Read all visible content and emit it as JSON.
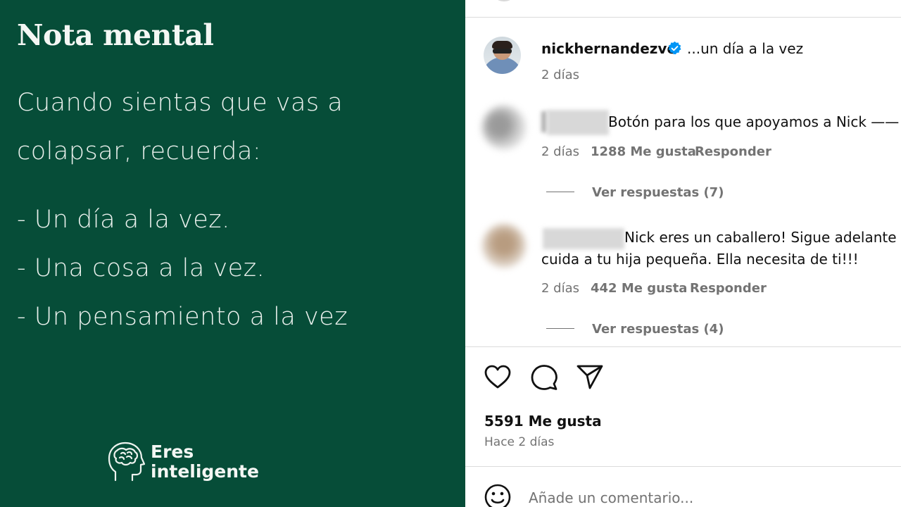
{
  "post_image": {
    "title": "Nota mental",
    "body_lines": [
      "Cuando sientas que vas a",
      "colapsar, recuerda:"
    ],
    "list_items": [
      "- Un día a la vez.",
      "- Una cosa a la vez.",
      "- Un pensamiento a la vez"
    ],
    "brand": {
      "line1": "Eres",
      "line2": "inteligente",
      "icon": "brain-head-icon"
    }
  },
  "caption": {
    "username": "nickhernandezve",
    "text": "...un día a la vez",
    "time": "2 días",
    "verified_icon": "verified-badge-icon"
  },
  "comments": [
    {
      "text": "Botón para los que apoyamos a Nick ——",
      "lines": [],
      "time": "2 días",
      "likes": "1288 Me gusta",
      "reply_label": "Responder",
      "replies_label": "Ver respuestas (7)"
    },
    {
      "text": "",
      "lines": [
        "Nick eres un caballero! Sigue adelante c",
        "cuida a tu hija pequeña. Ella necesita de ti!!!"
      ],
      "time": "2 días",
      "likes": "442 Me gusta",
      "reply_label": "Responder",
      "replies_label": "Ver respuestas (4)"
    }
  ],
  "actions": {
    "like_icon": "heart-icon",
    "comment_icon": "comment-bubble-icon",
    "share_icon": "send-icon"
  },
  "likes_total": "5591 Me gusta",
  "post_time": "Hace 2 días",
  "comment_box": {
    "placeholder": "Añade un comentario...",
    "emoji_icon": "emoji-icon"
  },
  "colors": {
    "post_background": "#064d38",
    "verified": "#0095f6",
    "secondary_text": "#737373"
  }
}
